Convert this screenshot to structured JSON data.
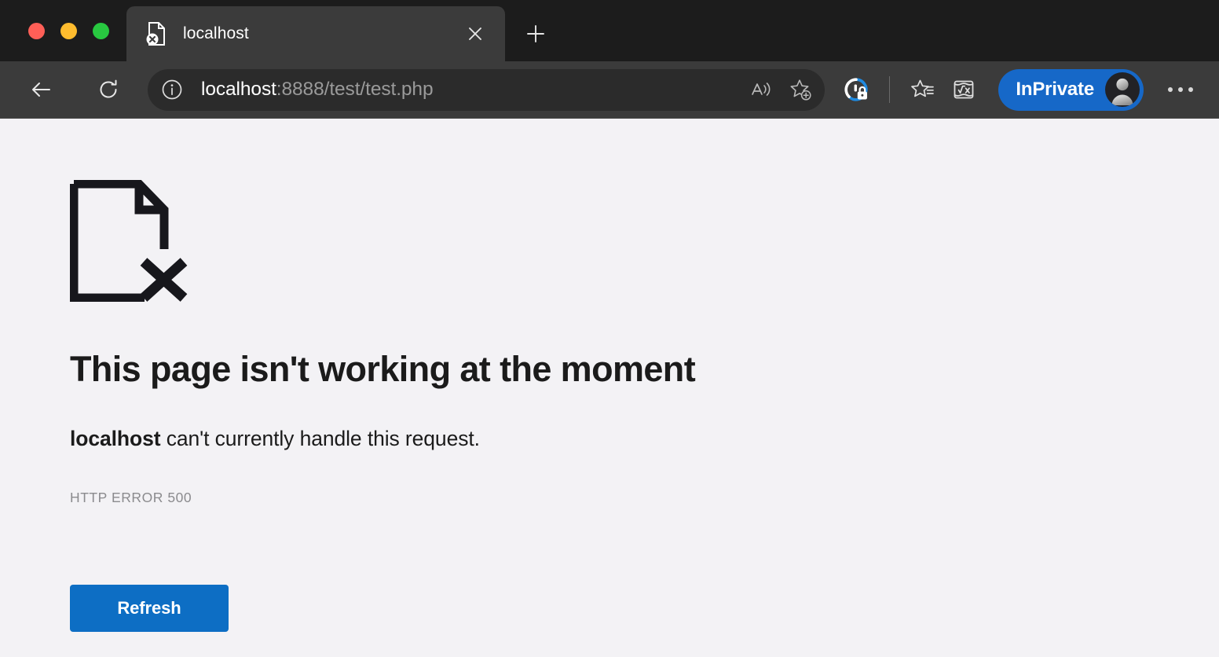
{
  "window": {
    "traffic_lights": [
      {
        "name": "close",
        "color": "#ff5f57"
      },
      {
        "name": "minimize",
        "color": "#febc2e"
      },
      {
        "name": "maximize",
        "color": "#28c840"
      }
    ]
  },
  "tabstrip": {
    "active_tab": {
      "title": "localhost",
      "favicon": "broken-page-icon",
      "close_label": "×"
    },
    "new_tab_label": "+"
  },
  "toolbar": {
    "back_icon": "arrow-left-icon",
    "refresh_icon": "refresh-icon",
    "address": {
      "site_info_icon": "info-circle-icon",
      "host": "localhost",
      "rest": ":8888/test/test.php",
      "full_url": "localhost:8888/test/test.php",
      "read_aloud_icon": "read-aloud-icon",
      "add_favorite_icon": "star-plus-icon"
    },
    "right_icons": [
      {
        "name": "tracking-prevention-icon",
        "label": "Tracking prevention"
      },
      {
        "name": "favorites-icon",
        "label": "Favorites"
      },
      {
        "name": "math-solver-icon",
        "label": "Math solver"
      }
    ],
    "inprivate": {
      "label": "InPrivate",
      "pill_color": "#1668c8",
      "avatar_icon": "person-avatar-icon"
    },
    "more_label": "···"
  },
  "page": {
    "background": "#f3f2f5",
    "error_icon": "broken-document-icon",
    "headline": "This page isn't working at the moment",
    "subhead_host": "localhost",
    "subhead_rest": " can't currently handle this request.",
    "error_code": "HTTP ERROR 500",
    "refresh_button": "Refresh",
    "refresh_button_color": "#0d6ec4"
  }
}
